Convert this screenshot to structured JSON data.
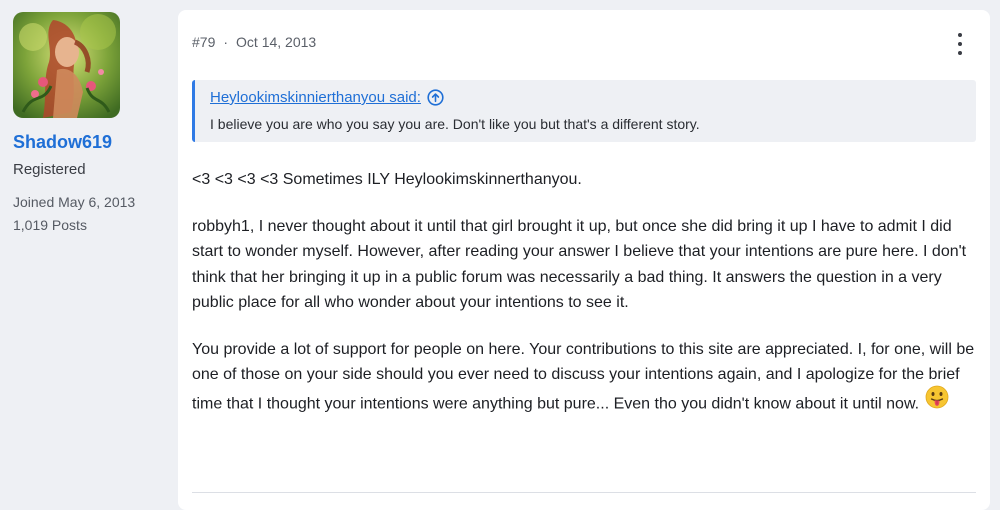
{
  "user": {
    "username": "Shadow619",
    "title": "Registered",
    "joined": "Joined May 6, 2013",
    "posts": "1,019 Posts",
    "avatar_icon": "avatar-fantasy-image"
  },
  "post": {
    "number": "#79",
    "date": "Oct 14, 2013",
    "menu_icon": "more-vertical-icon",
    "quote": {
      "author_line": "Heylookimskinnierthanyou said:",
      "text": "I believe you are who you say you are. Don't like you but that's a different story.",
      "icon": "arrow-up-circle-icon"
    },
    "paragraphs": [
      "<3 <3 <3 <3 Sometimes ILY Heylookimskinnerthanyou.",
      "robbyh1, I never thought about it until that girl brought it up, but once she did bring it up I have to admit I did start to wonder myself. However, after reading your answer I believe that your intentions are pure here. I don't think that her bringing it up in a public forum was necessarily a bad thing. It answers the question in a very public place for all who wonder about your intentions to see it.",
      "You provide a lot of support for people on here. Your contributions to this site are appreciated. I, for one, will be one of those on your side should you ever need to discuss your intentions again, and I apologize for the brief time that I thought your intentions were anything but pure... Even tho you didn't know about it until now."
    ],
    "emoji_icon": "tongue-out-emoji-icon"
  },
  "colors": {
    "page_bg": "#eef0f4",
    "link_blue": "#1f6fd6",
    "quote_bar": "#2f7ae5"
  }
}
